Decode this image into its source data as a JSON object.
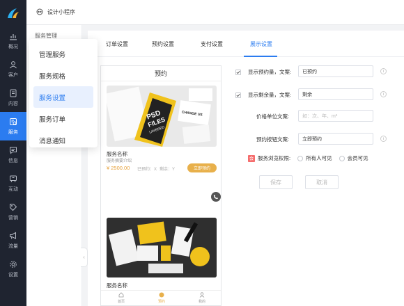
{
  "topbar": {
    "title": "设计小程序"
  },
  "rail": {
    "items": [
      {
        "label": "概况",
        "icon": "chart-icon"
      },
      {
        "label": "客户",
        "icon": "user-icon"
      },
      {
        "label": "内容",
        "icon": "document-icon"
      },
      {
        "label": "服务",
        "icon": "service-icon",
        "active": true
      },
      {
        "label": "信息",
        "icon": "message-icon"
      },
      {
        "label": "互动",
        "icon": "interact-icon"
      },
      {
        "label": "营销",
        "icon": "tag-icon"
      },
      {
        "label": "流量",
        "icon": "megaphone-icon"
      },
      {
        "label": "设置",
        "icon": "gear-icon"
      }
    ]
  },
  "subnav": {
    "header": "服务管理"
  },
  "menu": {
    "items": [
      "管理服务",
      "服务规格",
      "服务设置",
      "服务订单",
      "消息通知"
    ],
    "active": "服务设置"
  },
  "tabs": {
    "items": [
      "订单设置",
      "预约设置",
      "支付设置",
      "展示设置"
    ],
    "active": "展示设置"
  },
  "preview": {
    "title": "预约",
    "cover_text": [
      "PSD",
      "FILES",
      "LAYERED",
      "CHANGE US"
    ],
    "service_name": "服务名称",
    "service_desc": "服务摘要介绍",
    "price": "¥ 2500.00",
    "booked": "已预约：X",
    "remaining": "剩余：Y",
    "book_button": "立即预约",
    "service_name_2": "服务名称",
    "bottom_nav": [
      "首页",
      "预约",
      "我的"
    ]
  },
  "form": {
    "show_booked_label": "显示预约量，文案:",
    "show_booked_value": "已预约",
    "show_remaining_label": "显示剩余量，文案:",
    "show_remaining_value": "剩余",
    "price_unit_label": "价格单位文案:",
    "price_unit_placeholder": "如：次、年、m²",
    "book_button_label": "预约按钮文案:",
    "book_button_value": "立即预约",
    "browse_perm_label": "服务浏览权限:",
    "browse_perm_badge": "会",
    "perm_options": [
      "所有人可见",
      "会员可见"
    ],
    "info_mark": "i",
    "save": "保存",
    "cancel": "取消"
  },
  "colors": {
    "accent": "#2b7cf0",
    "rail_bg": "#1f2430",
    "gold": "#e8b04b",
    "badge": "#f56c6c"
  }
}
